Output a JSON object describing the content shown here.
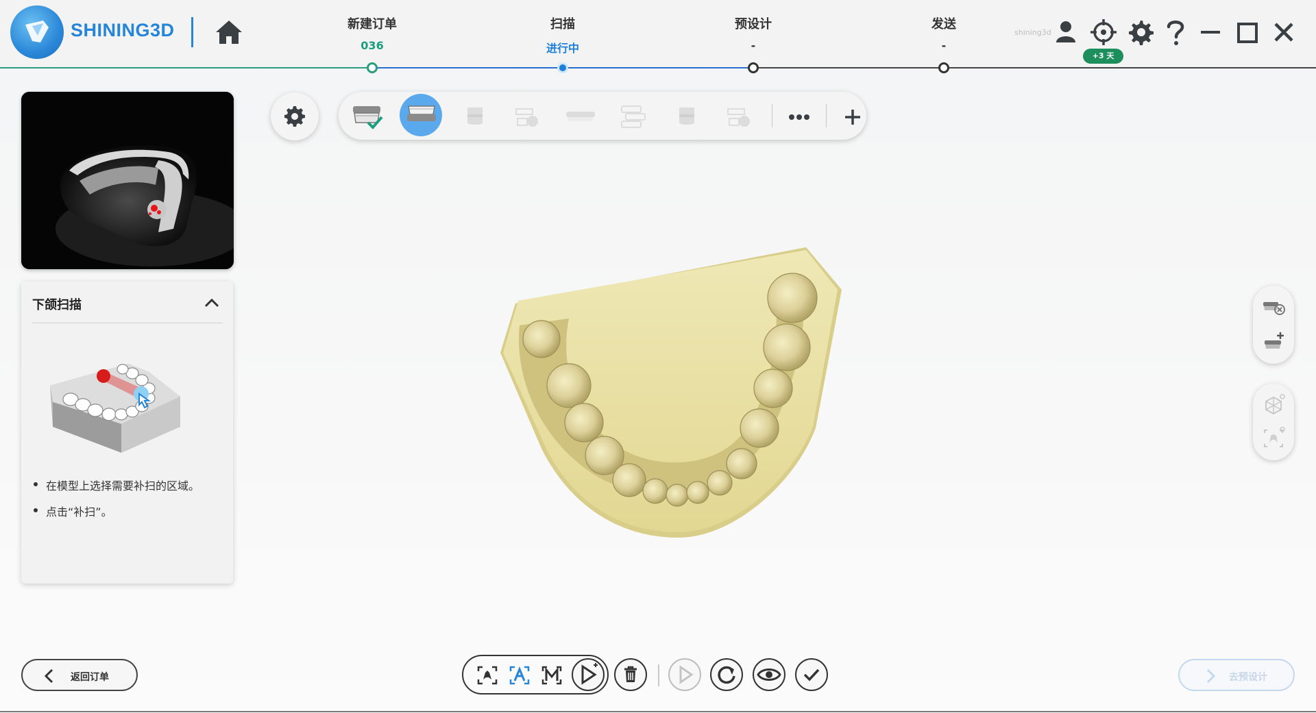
{
  "app": {
    "brand": "SHINING3D",
    "user_name": "shining3d",
    "trial_badge": "+3 天",
    "accent_color": "#2a9d7e",
    "brand_color": "#2585d8"
  },
  "steps": [
    {
      "title": "新建订单",
      "sub": "036",
      "state": "done",
      "sub_color": "#1a9e7d"
    },
    {
      "title": "扫描",
      "sub": "进行中",
      "state": "active",
      "sub_color": "#1f7fd8"
    },
    {
      "title": "预设计",
      "sub": "-",
      "state": "pending",
      "sub_color": "#333333"
    },
    {
      "title": "发送",
      "sub": "-",
      "state": "pending",
      "sub_color": "#333333"
    }
  ],
  "guide": {
    "title": "下颌扫描",
    "steps": [
      "在模型上选择需要补扫的区域。",
      "点击“补扫”。"
    ]
  },
  "toolbar": {
    "items": [
      {
        "icon": "upper-jaw-done-icon",
        "state": "done"
      },
      {
        "icon": "lower-jaw-icon",
        "state": "active"
      },
      {
        "icon": "tooth-icon",
        "state": "disabled"
      },
      {
        "icon": "occlusion-icon",
        "state": "disabled"
      },
      {
        "icon": "bite-tray-icon",
        "state": "disabled"
      },
      {
        "icon": "stack-icon",
        "state": "disabled"
      },
      {
        "icon": "tooth-icon",
        "state": "disabled"
      },
      {
        "icon": "occlusion-icon",
        "state": "disabled"
      }
    ]
  },
  "footer": {
    "back_label": "返回订单",
    "next_label": "去预设计"
  }
}
